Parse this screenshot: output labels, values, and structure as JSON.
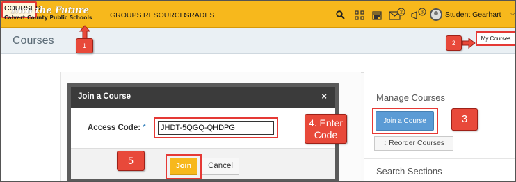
{
  "logo": {
    "line1": "Into the Future",
    "line2": "Calvert County Public Schools"
  },
  "nav": {
    "courses": "COURSES",
    "groups": "GROUPS",
    "resources": "RESOURCES",
    "grades": "GRADES"
  },
  "toolbar": {
    "search_icon": "search-icon",
    "apps_icon": "grid-icon",
    "calendar_icon": "calendar-icon",
    "messages_icon": "mail-icon",
    "notifications_icon": "megaphone-icon",
    "messages_badge": "2",
    "notifications_badge": "3"
  },
  "user": {
    "name": "Student Gearhart"
  },
  "page": {
    "title": "Courses",
    "my_courses": "My Courses"
  },
  "callouts": {
    "one": "1",
    "two": "2",
    "three": "3",
    "four_line1": "4. Enter",
    "four_line2": "Code",
    "five": "5"
  },
  "modal": {
    "title": "Join a Course",
    "close": "×",
    "access_label": "Access Code:",
    "required_mark": "*",
    "access_value": "JHDT-5QGQ-QHDPG",
    "join": "Join",
    "cancel": "Cancel"
  },
  "sidebar": {
    "manage_title": "Manage Courses",
    "join_course": "Join a Course",
    "reorder": "Reorder Courses",
    "search_sections": "Search Sections"
  },
  "colors": {
    "brand": "#f7b81c",
    "highlight": "#e53935",
    "callout": "#e8493a",
    "primary_button": "#5b9bd5"
  }
}
